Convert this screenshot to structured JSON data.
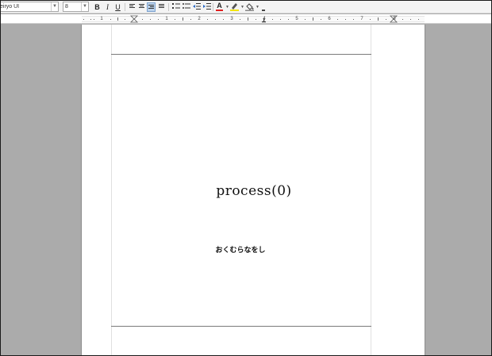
{
  "toolbar": {
    "font_name": "eiryo UI",
    "font_size": "8",
    "bold_label": "B",
    "italic_label": "I",
    "underline_label": "U",
    "font_color_label": "A",
    "font_color_accent": "#e02020",
    "highlight_accent": "#f2e400"
  },
  "ruler": {
    "numbers": [
      "1",
      "1",
      "2",
      "3",
      "4",
      "5",
      "6",
      "7",
      "8"
    ]
  },
  "document": {
    "title": "process(0)",
    "subtitle": "おくむらなをし"
  }
}
